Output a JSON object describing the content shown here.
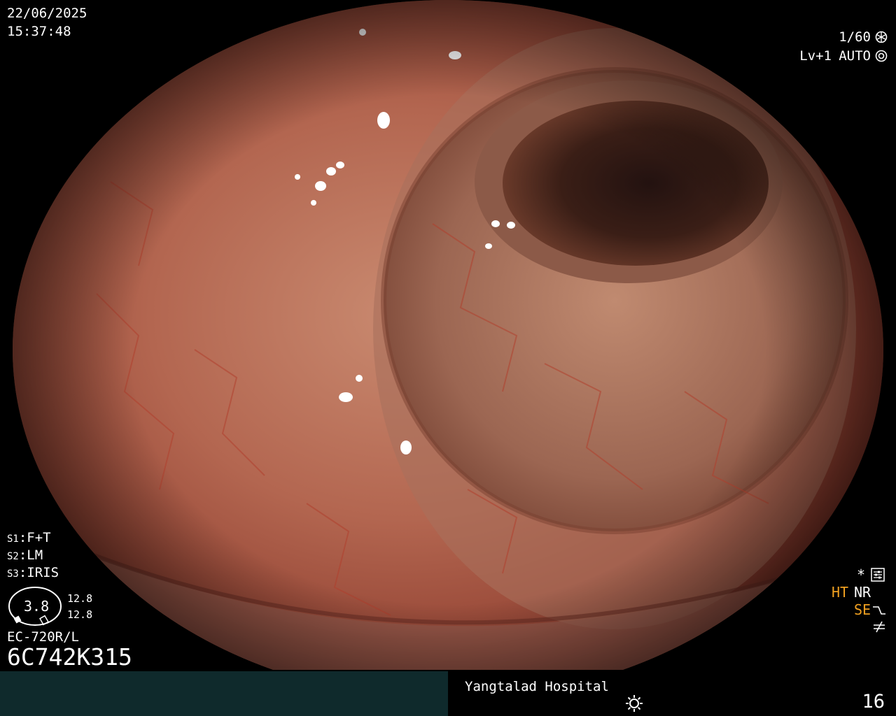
{
  "overlay": {
    "date": "22/06/2025",
    "time": "15:37:48",
    "shutter": "1/60",
    "shutter_icon": "aperture-icon",
    "level": "Lv+1",
    "mode": "AUTO",
    "mode_icon": "iris-icon",
    "settings": {
      "s1_label": "S1",
      "s1_value": ":F+T",
      "s2_label": "S2",
      "s2_value": ":LM",
      "s3_label": "S3",
      "s3_value": ":IRIS"
    },
    "gauge_value": "3.8",
    "gauge_right_top": "12.8",
    "gauge_right_bottom": "12.8",
    "model": "EC-720R/L",
    "serial": "6C742K315",
    "indicators": {
      "star": "*",
      "star_icon": "equalizer-icon",
      "ht": "HT",
      "nr": "NR",
      "se": "SE",
      "se_icon": "curve-icon",
      "freeze_icon": "not-equal-icon"
    },
    "hospital": "Yangtalad Hospital",
    "brightness_icon": "sun-icon",
    "frame_number": "16"
  },
  "colors": {
    "background": "#000000",
    "bar_left": "#0f2a2c",
    "indicator_orange": "#f0a020",
    "text": "#ffffff"
  }
}
